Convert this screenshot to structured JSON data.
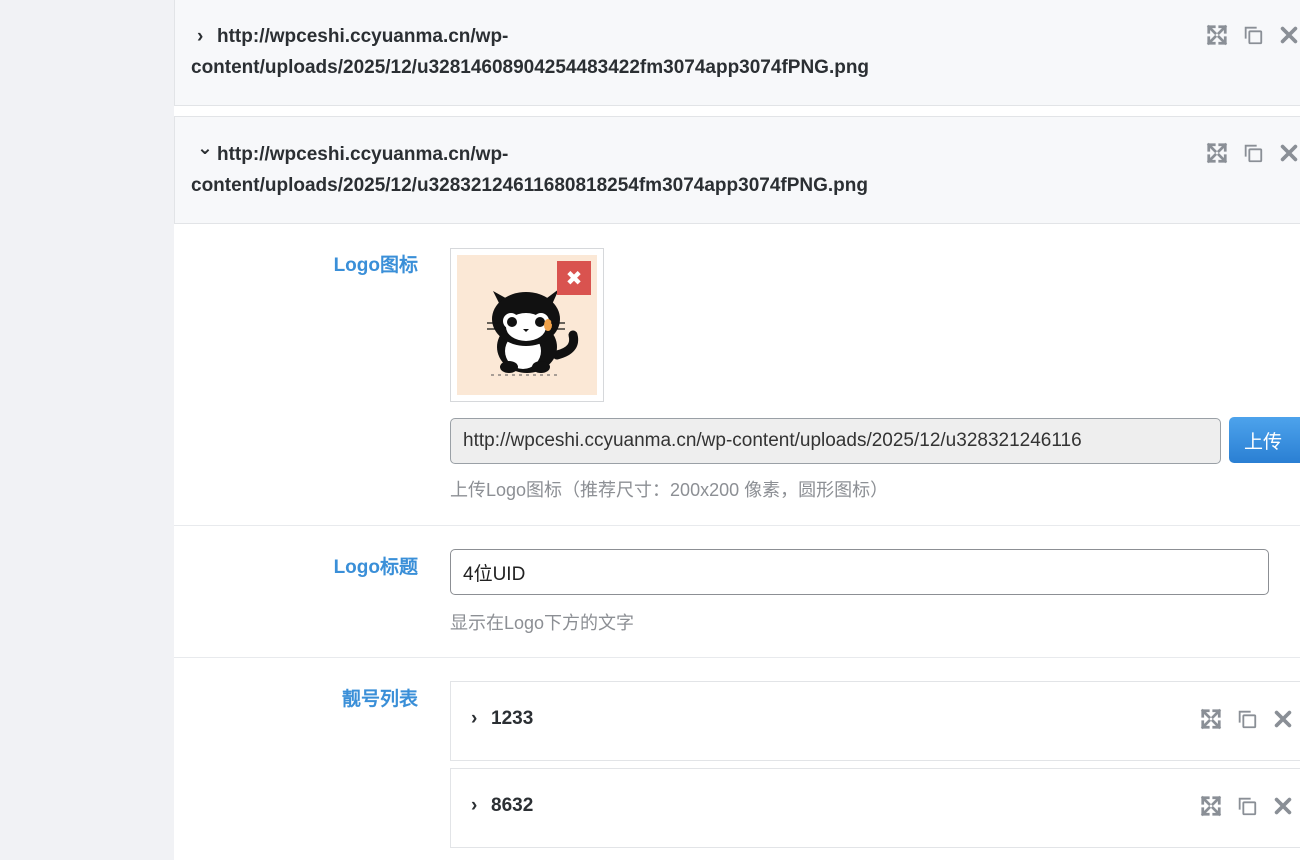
{
  "accordions": [
    {
      "title_line1": "http://wpceshi.ccyuanma.cn/wp-",
      "title_line2": "content/uploads/2025/12/u3281460890425448342 2fm3074app3074fPNG.png",
      "expanded": false
    },
    {
      "title_line1": "http://wpceshi.ccyuanma.cn/wp-",
      "title_line2": "content/uploads/2025/12/u3283212461168081825 4fm3074app3074fPNG.png",
      "expanded": true
    }
  ],
  "icons": {
    "collapsed": "›",
    "expanded": "⌄"
  },
  "logo_icon": {
    "label": "Logo图标",
    "url_value": "http://wpceshi.ccyuanma.cn/wp-content/uploads/2025/12/u328321246116",
    "upload_label": "上传",
    "help": "上传Logo图标（推荐尺寸：200x200 像素，圆形图标）"
  },
  "logo_title": {
    "label": "Logo标题",
    "value": "4位UID",
    "help": "显示在Logo下方的文字"
  },
  "number_list": {
    "label": "靓号列表",
    "items": [
      {
        "title": "1233"
      },
      {
        "title": "8632"
      }
    ]
  },
  "colors": {
    "accent_label": "#3a8fd8",
    "remove_red": "#d9534f",
    "button_blue": "#2a7fd3"
  }
}
